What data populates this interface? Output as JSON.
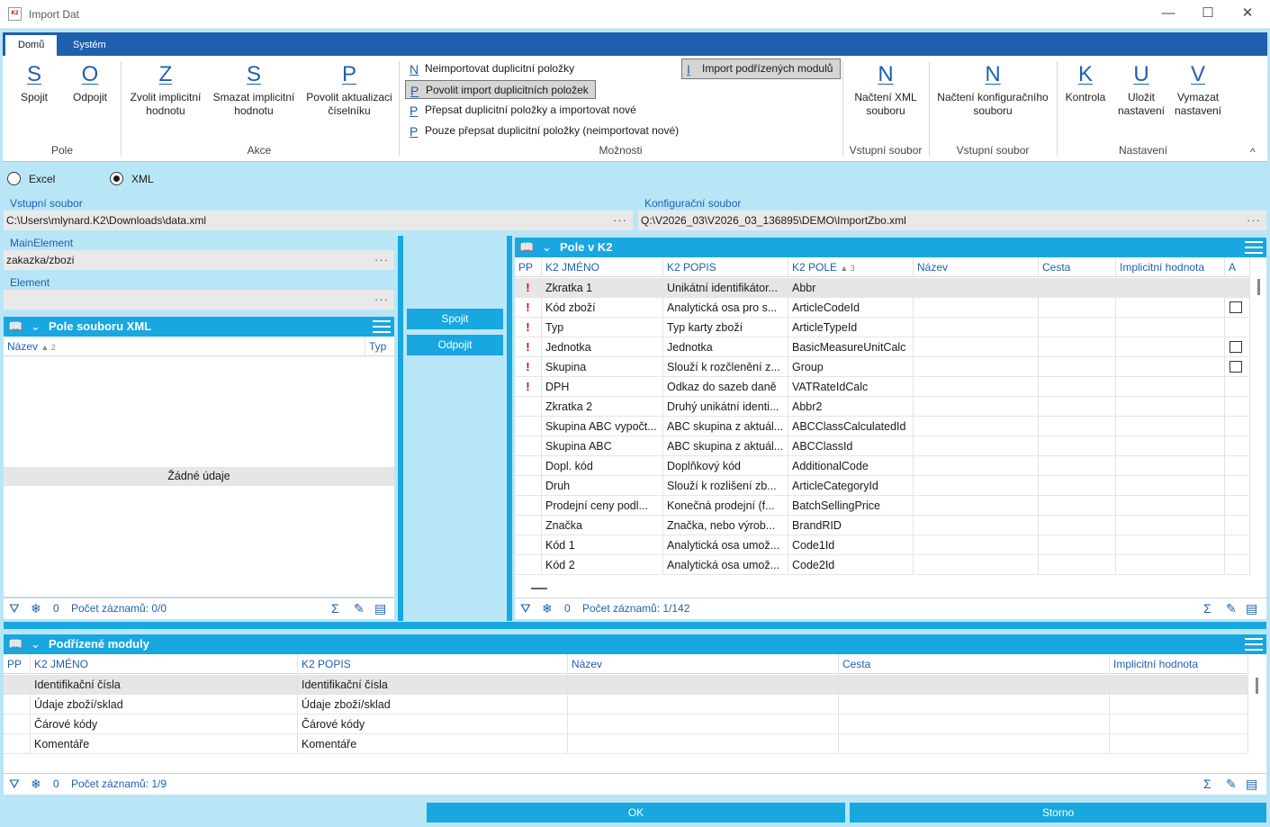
{
  "window": {
    "title": "Import Dat",
    "app_icon": "K2",
    "minimize": "—",
    "maximize": "☐",
    "close": "✕"
  },
  "ribbon": {
    "tabs": [
      "Domů",
      "Systém"
    ],
    "pole_group": {
      "label": "Pole",
      "buttons": [
        {
          "letter": "S",
          "label": "Spojit"
        },
        {
          "letter": "O",
          "label": "Odpojit"
        }
      ]
    },
    "akce_group": {
      "label": "Akce",
      "buttons": [
        {
          "letter": "Z",
          "label1": "Zvolit implicitní",
          "label2": "hodnotu"
        },
        {
          "letter": "S",
          "label1": "Smazat implicitní",
          "label2": "hodnotu"
        },
        {
          "letter": "P",
          "label1": "Povolit aktualizaci",
          "label2": "číselníku"
        }
      ]
    },
    "moznosti_group": {
      "label": "Možnosti",
      "options": [
        {
          "letter": "N",
          "label": "Neimportovat duplicitní položky"
        },
        {
          "letter": "P",
          "label": "Povolit import duplicitních položek"
        },
        {
          "letter": "P",
          "label": "Přepsat duplicitní položky a importovat nové"
        },
        {
          "letter": "P",
          "label": "Pouze přepsat duplicitní položky (neimportovat nové)"
        }
      ],
      "toggle": {
        "letter": "I",
        "label": "Import podřízených modulů"
      }
    },
    "vstup1_group": {
      "label": "Vstupní soubor",
      "letter": "N",
      "label1": "Načtení XML",
      "label2": "souboru"
    },
    "vstup2_group": {
      "label": "Vstupní soubor",
      "letter": "N",
      "label1": "Načtení konfiguračního",
      "label2": "souboru"
    },
    "nastaveni_group": {
      "label": "Nastavení",
      "buttons": [
        {
          "letter": "K",
          "label1": "Kontrola",
          "label2": ""
        },
        {
          "letter": "U",
          "label1": "Uložit",
          "label2": "nastavení"
        },
        {
          "letter": "V",
          "label1": "Vymazat",
          "label2": "nastavení"
        }
      ]
    },
    "collapse": "^"
  },
  "format": {
    "excel": "Excel",
    "xml": "XML",
    "selected": "XML"
  },
  "input_file": {
    "label": "Vstupní soubor",
    "value": "C:\\Users\\mlynard.K2\\Downloads\\data.xml",
    "ellipsis": "···"
  },
  "config_file": {
    "label": "Konfigurační soubor",
    "value": "Q:\\V2026_03\\V2026_03_136895\\DEMO\\ImportZbo.xml",
    "ellipsis": "···"
  },
  "main_element": {
    "label": "MainElement",
    "value": "zakazka/zbozi",
    "ellipsis": "···"
  },
  "element": {
    "label": "Element",
    "value": "",
    "ellipsis": "···"
  },
  "xml_panel": {
    "title": "Pole souboru XML",
    "columns": {
      "nazev": "Název",
      "nazev_sort": "▲ 2",
      "typ": "Typ"
    },
    "empty": "Žádné údaje",
    "status": {
      "count": "0",
      "records": "Počet záznamů: 0/0"
    }
  },
  "middle": {
    "connect": "Spojit",
    "disconnect": "Odpojit"
  },
  "k2_panel": {
    "title": "Pole v K2",
    "columns": {
      "pp": "PP",
      "jmeno": "K2 JMÉNO",
      "popis": "K2 POPIS",
      "pole": "K2 POLE",
      "pole_sort": "▲ 3",
      "nazev": "Název",
      "cesta": "Cesta",
      "impl": "Implicitní hodnota",
      "a": "A"
    },
    "rows": [
      {
        "pp": "!",
        "jmeno": "Zkratka 1",
        "popis": "Unikátní identifikátor...",
        "pole": "Abbr",
        "a": false
      },
      {
        "pp": "!",
        "jmeno": "Kód zboží",
        "popis": "Analytická osa pro s...",
        "pole": "ArticleCodeId",
        "a": true
      },
      {
        "pp": "!",
        "jmeno": "Typ",
        "popis": "Typ karty zboží",
        "pole": "ArticleTypeId",
        "a": false
      },
      {
        "pp": "!",
        "jmeno": "Jednotka",
        "popis": "Jednotka",
        "pole": "BasicMeasureUnitCalc",
        "a": true
      },
      {
        "pp": "!",
        "jmeno": "Skupina",
        "popis": "Slouží k rozčlenění z...",
        "pole": "Group",
        "a": true
      },
      {
        "pp": "!",
        "jmeno": "DPH",
        "popis": "Odkaz do sazeb daně",
        "pole": "VATRateIdCalc",
        "a": false
      },
      {
        "pp": "",
        "jmeno": "Zkratka 2",
        "popis": "Druhý unikátní identi...",
        "pole": "Abbr2",
        "a": false
      },
      {
        "pp": "",
        "jmeno": "Skupina ABC vypočt...",
        "popis": "ABC skupina z aktuál...",
        "pole": "ABCClassCalculatedId",
        "a": false
      },
      {
        "pp": "",
        "jmeno": "Skupina ABC",
        "popis": "ABC skupina z aktuál...",
        "pole": "ABCClassId",
        "a": false
      },
      {
        "pp": "",
        "jmeno": "Dopl. kód",
        "popis": "Doplňkový kód",
        "pole": "AdditionalCode",
        "a": false
      },
      {
        "pp": "",
        "jmeno": "Druh",
        "popis": "Slouží k rozlišení zb...",
        "pole": "ArticleCategoryId",
        "a": false
      },
      {
        "pp": "",
        "jmeno": "Prodejní ceny podl...",
        "popis": "Konečná prodejní (f...",
        "pole": "BatchSellingPrice",
        "a": false
      },
      {
        "pp": "",
        "jmeno": "Značka",
        "popis": "Značka, nebo výrob...",
        "pole": "BrandRID",
        "a": false
      },
      {
        "pp": "",
        "jmeno": "Kód 1",
        "popis": "Analytická osa umož...",
        "pole": "Code1Id",
        "a": false
      },
      {
        "pp": "",
        "jmeno": "Kód 2",
        "popis": "Analytická osa umož...",
        "pole": "Code2Id",
        "a": false
      }
    ],
    "status": {
      "count": "0",
      "records": "Počet záznamů: 1/142"
    }
  },
  "sub_panel": {
    "title": "Podřízené moduly",
    "columns": {
      "pp": "PP",
      "jmeno": "K2 JMÉNO",
      "popis": "K2 POPIS",
      "nazev": "Název",
      "cesta": "Cesta",
      "impl": "Implicitní hodnota"
    },
    "rows": [
      {
        "jmeno": "Identifikační čísla",
        "popis": "Identifikační čísla"
      },
      {
        "jmeno": "Údaje zboží/sklad",
        "popis": "Údaje zboží/sklad"
      },
      {
        "jmeno": "Čárové kódy",
        "popis": "Čárové kódy"
      },
      {
        "jmeno": "Komentáře",
        "popis": "Komentáře"
      }
    ],
    "status": {
      "count": "0",
      "records": "Počet záznamů: 1/9"
    }
  },
  "footer": {
    "ok": "OK",
    "cancel": "Storno"
  }
}
